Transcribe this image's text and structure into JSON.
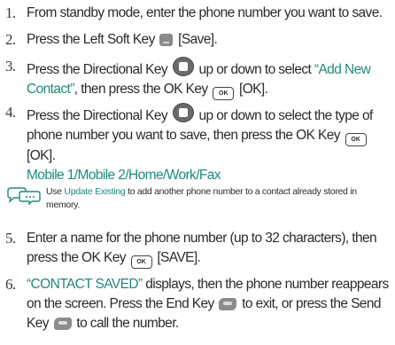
{
  "steps": [
    {
      "number": "1.",
      "text": "From standby mode, enter the phone number you want to save."
    },
    {
      "number": "2.",
      "before": "Press the Left Soft Key",
      "after": "[Save]."
    },
    {
      "number": "3.",
      "before": "Press the Directional Key",
      "middle": "up or down to select",
      "highlight": "“Add New Contact”",
      "middle2": ", then press the OK Key",
      "after": "[OK]."
    },
    {
      "number": "4.",
      "before": "Press the Directional Key",
      "middle": "up or down to select the type of phone number you want to save, then press the OK Key",
      "after": "[OK].",
      "options": [
        "Mobile 1",
        "/",
        "Mobile 2",
        "/",
        "Home",
        "/",
        "Work",
        "/",
        "Fax"
      ]
    },
    {
      "number": "5.",
      "before": "Enter a name for the phone number (up to 32 characters), then press the OK Key",
      "after": "[SAVE]."
    },
    {
      "number": "6.",
      "highlight": "“CONTACT SAVED”",
      "before": " displays, then the phone number reappears on the screen. Press the End Key",
      "middle": "to exit, or press the Send Key",
      "after": "to call the number."
    }
  ],
  "note": {
    "before": "Use",
    "link": "Update Existing",
    "after": "to add another phone number to a contact already stored in memory."
  },
  "keys": {
    "ok_label": "OK"
  },
  "colors": {
    "accent": "#1f8a7a",
    "text": "#2b2b2b"
  }
}
